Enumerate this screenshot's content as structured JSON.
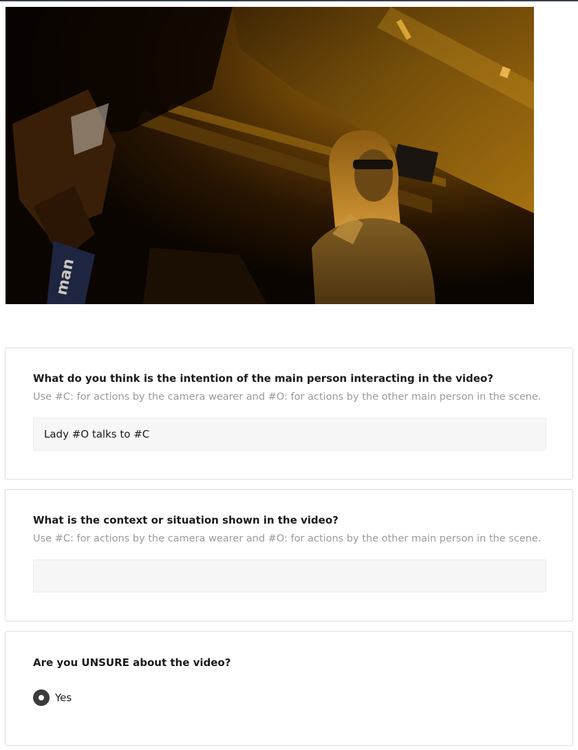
{
  "video": {
    "sign_text": "man"
  },
  "questions": [
    {
      "title": "What do you think is the intention of the main person interacting in the video?",
      "hint": "Use #C: for actions by the camera wearer and #O: for actions by the other main person in the scene.",
      "value": "Lady #O talks to #C",
      "placeholder": ""
    },
    {
      "title": "What is the context or situation shown in the video?",
      "hint": "Use #C: for actions by the camera wearer and #O: for actions by the other main person in the scene.",
      "value": "",
      "placeholder": ""
    },
    {
      "title": "Are you UNSURE about the video?",
      "options": [
        "Yes"
      ],
      "selected": "Yes"
    }
  ]
}
